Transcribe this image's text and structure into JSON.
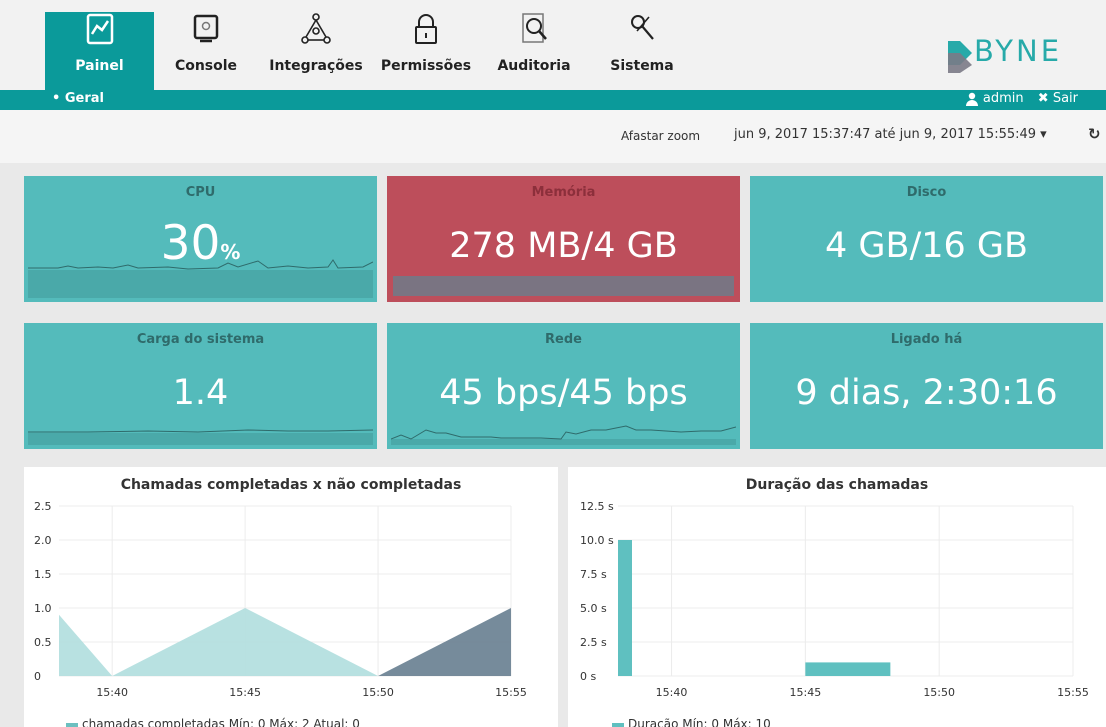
{
  "nav": {
    "items": [
      {
        "label": "Painel",
        "active": true
      },
      {
        "label": "Console"
      },
      {
        "label": "Integrações"
      },
      {
        "label": "Permissões"
      },
      {
        "label": "Auditoria"
      },
      {
        "label": "Sistema"
      }
    ],
    "logo_text": "BYNE"
  },
  "subnav": {
    "current": "• Geral",
    "user": "admin",
    "logout": "Sair"
  },
  "toolbar": {
    "zoom_out": "Afastar zoom",
    "range": "jun 9, 2017 15:37:47 até jun 9, 2017 15:55:49 ▾",
    "refresh_icon": "refresh-icon"
  },
  "cards": {
    "cpu": {
      "title": "CPU",
      "value": "30",
      "unit": "%"
    },
    "memory": {
      "title": "Memória",
      "value": "278 MB/4 GB"
    },
    "disk": {
      "title": "Disco",
      "value": "4 GB/16 GB"
    },
    "load": {
      "title": "Carga do sistema",
      "value": "1.4"
    },
    "network": {
      "title": "Rede",
      "value": "45 bps/45 bps"
    },
    "uptime": {
      "title": "Ligado há",
      "value": "9 dias, 2:30:16"
    }
  },
  "colors": {
    "teal": "#54bbbb",
    "red": "#bd4e5b",
    "nav_active": "#0b9a9a"
  },
  "chart_data": [
    {
      "type": "area",
      "title": "Chamadas completadas x não completadas",
      "xlabel": "",
      "ylabel": "",
      "x_ticks": [
        "15:40",
        "15:45",
        "15:50",
        "15:55"
      ],
      "y_ticks": [
        "0",
        "0.5",
        "1.0",
        "1.5",
        "2.0",
        "2.5"
      ],
      "ylim": [
        0,
        2.5
      ],
      "x": [
        "15:38",
        "15:40",
        "15:45",
        "15:50",
        "15:55"
      ],
      "series": [
        {
          "name": "chamadas completadas",
          "values": [
            0.9,
            0,
            1,
            0,
            0
          ],
          "color": "#b4dfdf"
        },
        {
          "values": [
            0,
            0,
            0,
            0,
            1
          ],
          "color": "#6f8596"
        }
      ],
      "legend": "chamadas completadas  Mín: 0  Máx: 2  Atual: 0",
      "legend_color": "#6cc0c0"
    },
    {
      "type": "bar",
      "title": "Duração das chamadas",
      "xlabel": "",
      "ylabel": "",
      "x_ticks": [
        "15:40",
        "15:45",
        "15:50",
        "15:55"
      ],
      "y_ticks": [
        "0 s",
        "2.5 s",
        "5.0 s",
        "7.5 s",
        "10.0 s",
        "12.5 s"
      ],
      "ylim": [
        0,
        12.5
      ],
      "bars": [
        {
          "x": "15:38",
          "value": 10
        },
        {
          "x": "15:45",
          "value": 1
        }
      ],
      "series_name": "Duração",
      "legend": "Duração  Mín: 0  Máx: 10",
      "bar_color": "#5fc0c0"
    }
  ]
}
